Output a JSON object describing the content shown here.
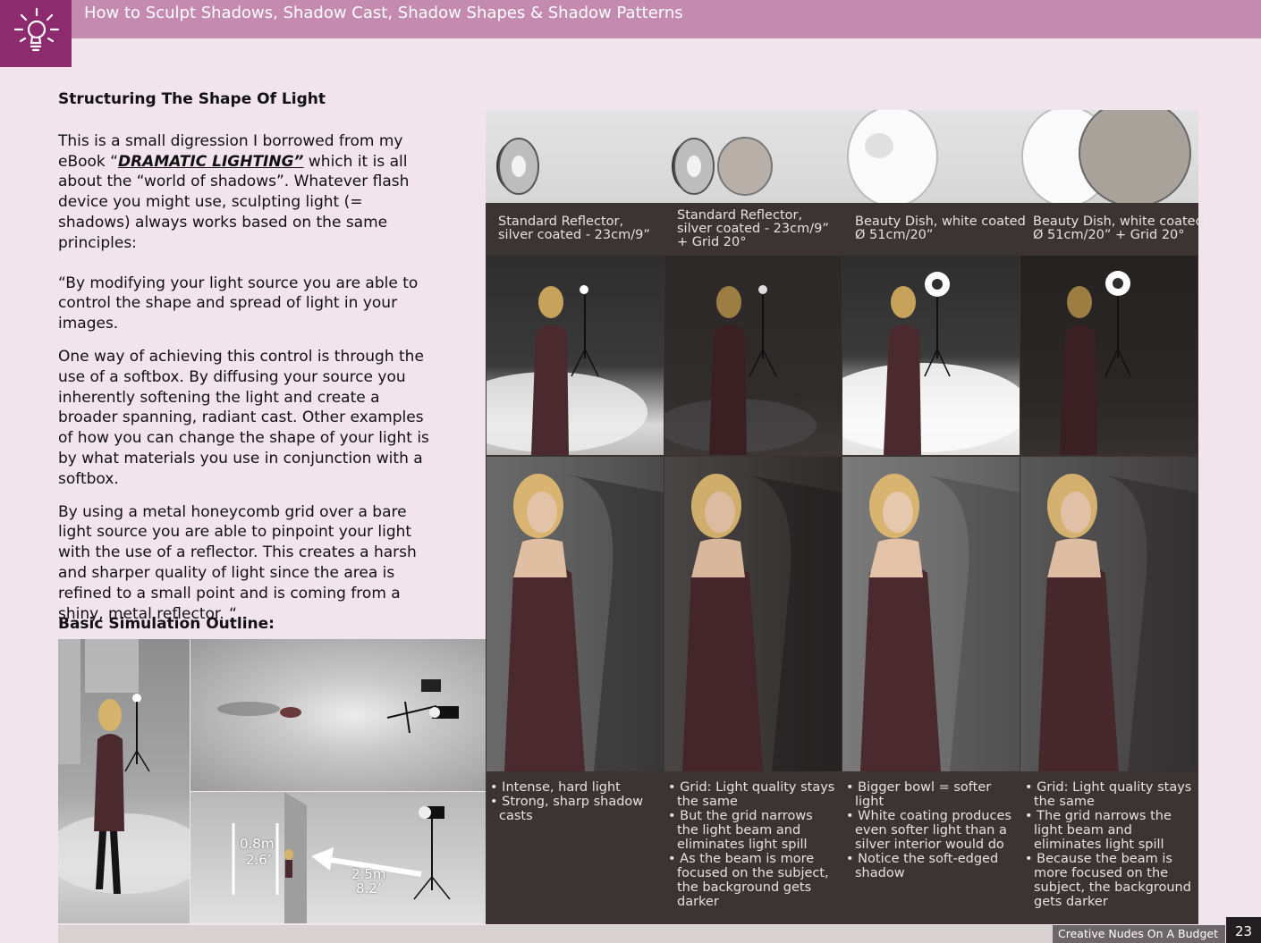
{
  "header": {
    "title": "How to Sculpt Shadows, Shadow Cast, Shadow Shapes & Shadow Patterns",
    "logo_icon": "lightbulb-icon",
    "accent_color": "#c48ab0",
    "logo_color": "#8e2a6e"
  },
  "article": {
    "heading": "Structuring The Shape Of Light",
    "intro_before": "This is a small digression I borrowed from my eBook “",
    "intro_link": "DRAMATIC LIGHTING”",
    "intro_after": " which it is all about the “world of shadows”. Whatever flash device you might use, sculpting light (= shadows) always works based on the same principles:",
    "quote_1": "“By modifying your light source you are able to control the shape and spread of light in your images.",
    "quote_2": "One way of achieving this control is through the use of a softbox. By diffusing your source you inherently softening the light and create a broader spanning, radiant cast. Other examples of how you can change the shape of your light is by what materials you use in conjunction with a softbox.",
    "quote_3": "By using a metal honeycomb grid over a bare light source you are able to pinpoint your light with the use of a reflector. This creates a harsh and sharper quality of light since the area is refined to a small point and is coming from a shiny, metal reflector. “",
    "sim_heading": "Basic Simulation Outline:"
  },
  "simulation": {
    "height_m": "0.8m",
    "height_ft": "2.6’",
    "distance_m": "2.5m",
    "distance_ft": "8.2’"
  },
  "columns": [
    {
      "caption": [
        "Standard Reflector,",
        "silver coated - 23cm/9”"
      ],
      "bullets": [
        "Intense, hard light",
        "Strong, sharp shadow casts"
      ]
    },
    {
      "caption": [
        "Standard Reflector,",
        "silver coated - 23cm/9”",
        "+ Grid 20°"
      ],
      "bullets": [
        "Grid: Light quality stays the same",
        "But the grid narrows the light beam and eliminates light spill",
        "As the beam is more focused on the subject, the background gets darker"
      ]
    },
    {
      "caption": [
        "Beauty Dish, white coated",
        "Ø 51cm/20”"
      ],
      "bullets": [
        "Bigger bowl = softer light",
        "White coating produces even softer light than a silver interior would do",
        "Notice the soft-edged shadow"
      ]
    },
    {
      "caption": [
        "Beauty Dish, white coated",
        "Ø 51cm/20” + Grid 20°"
      ],
      "bullets": [
        "Grid: Light quality stays the same",
        "The grid narrows the light beam and eliminates light spill",
        "Because the beam is more focused on the subject, the background gets darker"
      ]
    }
  ],
  "footer": {
    "book_title": "Creative Nudes On A Budget",
    "page_number": "23"
  }
}
